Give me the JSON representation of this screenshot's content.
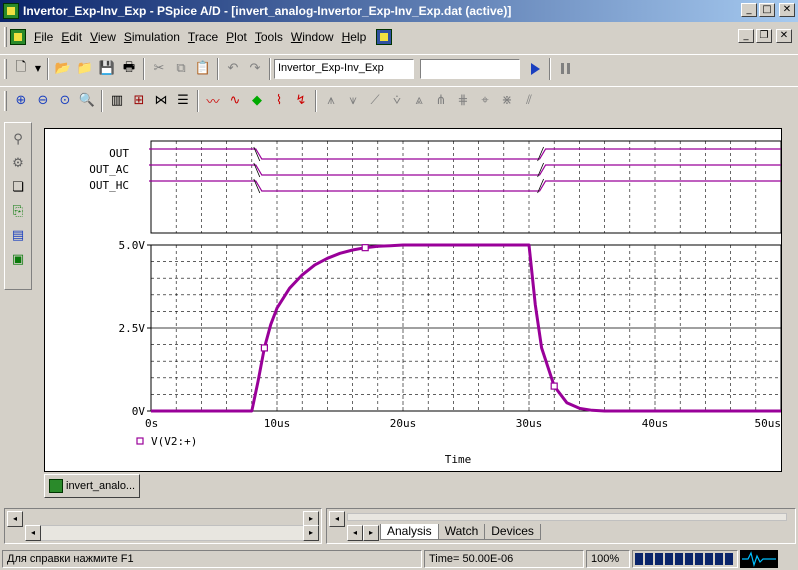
{
  "window": {
    "title": "Invertor_Exp-Inv_Exp - PSpice A/D - [invert_analog-Invertor_Exp-Inv_Exp.dat (active)]"
  },
  "menu": {
    "items": [
      {
        "label": "File",
        "accel": "F",
        "rest": "ile"
      },
      {
        "label": "Edit",
        "accel": "E",
        "rest": "dit"
      },
      {
        "label": "View",
        "accel": "V",
        "rest": "iew"
      },
      {
        "label": "Simulation",
        "accel": "S",
        "rest": "imulation"
      },
      {
        "label": "Trace",
        "accel": "T",
        "rest": "race"
      },
      {
        "label": "Plot",
        "accel": "P",
        "rest": "lot"
      },
      {
        "label": "Tools",
        "accel": "T",
        "rest": "ools"
      },
      {
        "label": "Window",
        "accel": "W",
        "rest": "indow"
      },
      {
        "label": "Help",
        "accel": "H",
        "rest": "elp"
      }
    ]
  },
  "toolbar": {
    "profile_value": "Invertor_Exp-Inv_Exp",
    "secondary_value": ""
  },
  "chart_data": {
    "type": "line",
    "digital": {
      "signals": [
        "OUT",
        "OUT_AC",
        "OUT_HC"
      ],
      "transitions_us": [
        8,
        31
      ],
      "state": "high-low-high"
    },
    "analog": {
      "series": [
        {
          "name": "V(V2:+)",
          "color": "#990099",
          "x_us": [
            0,
            8,
            8.5,
            9,
            9.5,
            10,
            11,
            12,
            13,
            14,
            15,
            16,
            17,
            18,
            19,
            20,
            30,
            30.5,
            31,
            32,
            33,
            34,
            35,
            36,
            50
          ],
          "y_v": [
            0,
            0,
            0.9,
            1.9,
            2.6,
            3.1,
            3.7,
            4.1,
            4.4,
            4.6,
            4.75,
            4.85,
            4.92,
            4.96,
            4.98,
            5.0,
            5.0,
            3.2,
            1.9,
            0.75,
            0.25,
            0.08,
            0.02,
            0.0,
            0.0
          ],
          "markers_x_us": [
            9,
            17,
            32
          ]
        }
      ],
      "xlim_us": [
        0,
        50
      ],
      "ylim_v": [
        0,
        5
      ],
      "x_ticks": [
        "0s",
        "10us",
        "20us",
        "30us",
        "40us",
        "50us"
      ],
      "y_ticks": [
        "0V",
        "2.5V",
        "5.0V"
      ],
      "xlabel": "Time",
      "grid": true
    }
  },
  "workspace": {
    "doc_tab": "invert_analo..."
  },
  "panes": {
    "tabs": [
      "Analysis",
      "Watch",
      "Devices"
    ]
  },
  "status": {
    "help": "Для справки нажмите F1",
    "time": "Time= 50.00E-06",
    "zoom": "100%"
  },
  "colors": {
    "trace": "#990099",
    "title_start": "#0a246a",
    "title_end": "#a6caf0"
  }
}
